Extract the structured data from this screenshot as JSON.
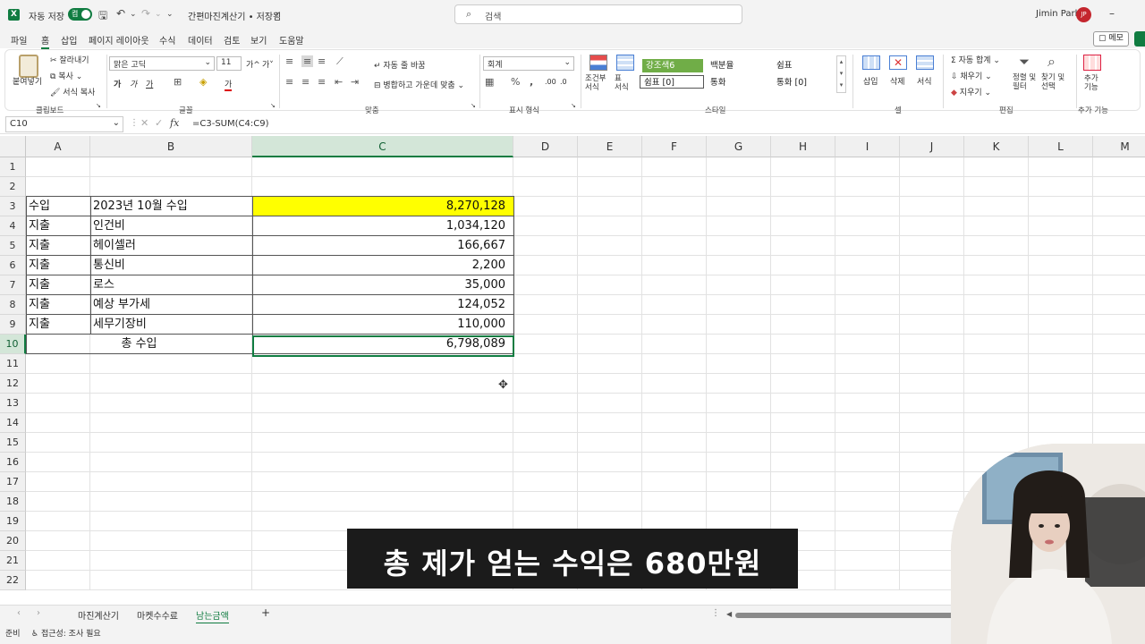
{
  "titlebar": {
    "app_logo": "X",
    "autosave_label": "자동 저장",
    "autosave_state": "켬",
    "doc_title": "간편마진계산기 • 저장됨",
    "search_placeholder": "검색",
    "user_name": "Jimin Park",
    "user_initials": "JP",
    "minimize": "–"
  },
  "menu": [
    "파일",
    "홈",
    "삽입",
    "페이지 레이아웃",
    "수식",
    "데이터",
    "검토",
    "보기",
    "도움말"
  ],
  "menu_active": "홈",
  "memo_label": "메모",
  "ribbon": {
    "clipboard": {
      "paste": "붙여넣기",
      "cut": "잘라내기",
      "copy": "복사",
      "format_painter": "서식 복사",
      "group": "클립보드"
    },
    "font": {
      "name": "맑은 고딕",
      "size": "11",
      "grow": "가^",
      "shrink": "가˅",
      "bold": "가",
      "italic": "가",
      "underline": "가",
      "color": "가",
      "group": "글꼴"
    },
    "align": {
      "wrap": "자동 줄 바꿈",
      "merge": "병합하고 가운데 맞춤",
      "group": "맞춤"
    },
    "number": {
      "format": "회계",
      "group": "표시 형식"
    },
    "styles": {
      "cond": "조건부 서식",
      "table": "표 서식",
      "cells": [
        "강조색6",
        "백분율",
        "쉼표",
        "쉼표 [0]",
        "통화",
        "통화 [0]"
      ],
      "group": "스타일"
    },
    "cells": {
      "insert": "삽입",
      "delete": "삭제",
      "format": "서식",
      "group": "셀"
    },
    "editing": {
      "autosum": "자동 합계",
      "fill": "채우기",
      "clear": "지우기",
      "sort": "정렬 및 필터",
      "find": "찾기 및 선택",
      "group": "편집"
    },
    "addins": {
      "label": "추가 기능",
      "group": "추가 기능"
    }
  },
  "formula_bar": {
    "name_box": "C10",
    "fx": "fx",
    "formula": "=C3-SUM(C4:C9)"
  },
  "columns": [
    "A",
    "B",
    "C",
    "D",
    "E",
    "F",
    "G",
    "H",
    "I",
    "J",
    "K",
    "L",
    "M"
  ],
  "rows": [
    "1",
    "2",
    "3",
    "4",
    "5",
    "6",
    "7",
    "8",
    "9",
    "10",
    "11",
    "12",
    "13",
    "14",
    "15",
    "16",
    "17",
    "18",
    "19",
    "20",
    "21",
    "22"
  ],
  "table": [
    {
      "row": 3,
      "a": "수입",
      "b": "2023년 10월 수입",
      "c": "8,270,128"
    },
    {
      "row": 4,
      "a": "지출",
      "b": "인건비",
      "c": "1,034,120"
    },
    {
      "row": 5,
      "a": "지출",
      "b": "헤이셀러",
      "c": "166,667"
    },
    {
      "row": 6,
      "a": "지출",
      "b": "통신비",
      "c": "2,200"
    },
    {
      "row": 7,
      "a": "지출",
      "b": "로스",
      "c": "35,000"
    },
    {
      "row": 8,
      "a": "지출",
      "b": "예상 부가세",
      "c": "124,052"
    },
    {
      "row": 9,
      "a": "지출",
      "b": "세무기장비",
      "c": "110,000"
    }
  ],
  "total": {
    "label": "총 수입",
    "value": "6,798,089"
  },
  "highlight_color": "#ffff00",
  "accent_color": "#107c41",
  "sheet_tabs": [
    "마진계산기",
    "마켓수수료",
    "남는금액"
  ],
  "sheet_active": "남는금액",
  "statusbar": {
    "ready": "준비",
    "accessibility": "접근성: 조사 필요"
  },
  "subtitle": "총 제가 얻는 수익은 680만원"
}
